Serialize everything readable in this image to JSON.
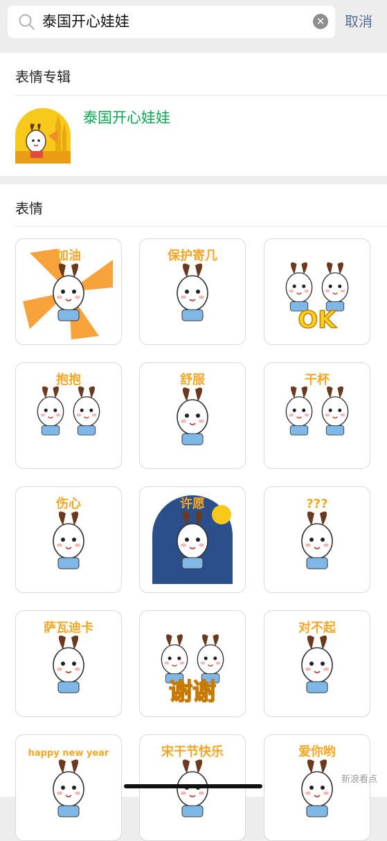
{
  "search": {
    "query": "泰国开心娃娃",
    "cancel_label": "取消"
  },
  "album_section": {
    "title": "表情专辑",
    "album_name": "泰国开心娃娃"
  },
  "sticker_section": {
    "title": "表情",
    "stickers": [
      {
        "caption": "加油"
      },
      {
        "caption": "保护寄几"
      },
      {
        "caption": "OK"
      },
      {
        "caption": "抱抱"
      },
      {
        "caption": "舒服"
      },
      {
        "caption": "干杯"
      },
      {
        "caption": "伤心"
      },
      {
        "caption": "许愿"
      },
      {
        "caption": "???"
      },
      {
        "caption": "萨瓦迪卡"
      },
      {
        "caption": "谢谢"
      },
      {
        "caption": "对不起"
      },
      {
        "caption": "happy new year"
      },
      {
        "caption": "宋干节快乐"
      },
      {
        "caption": "爱你哟"
      }
    ]
  },
  "watermark": "新浪看点",
  "colors": {
    "accent_green": "#07a94f",
    "link_blue": "#576b95",
    "sticker_orange": "#f5a623",
    "doll_brown": "#6b3a1e"
  }
}
